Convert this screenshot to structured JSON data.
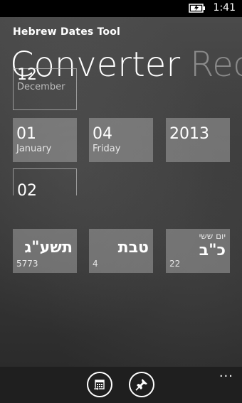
{
  "status": {
    "time": "1:41",
    "battery_icon": "battery-charging-icon"
  },
  "header": {
    "app_title": "Hebrew Dates Tool"
  },
  "pivot": {
    "active": "Converter",
    "next": "Recu"
  },
  "gregorian": {
    "day": {
      "number": "12",
      "label": "December"
    },
    "month": {
      "number": "01",
      "label": "January"
    },
    "weekday": {
      "number": "04",
      "label": "Friday"
    },
    "year": {
      "number": "2013"
    },
    "hour": {
      "number": "02"
    }
  },
  "hebrew": {
    "year": {
      "main": "תשע\"ג",
      "sub": "5773"
    },
    "month": {
      "main": "טבת",
      "sub": "4"
    },
    "day": {
      "top": "יום ששי",
      "main": "כ\"ב",
      "sub": "22"
    }
  },
  "app_bar": {
    "buttons": [
      {
        "icon": "calendar-icon"
      },
      {
        "icon": "pin-icon"
      }
    ],
    "more_label": "..."
  },
  "colors": {
    "tile": "#8c8c8c",
    "app_bar": "#1f1f1f",
    "background": "#3d3d3d"
  }
}
